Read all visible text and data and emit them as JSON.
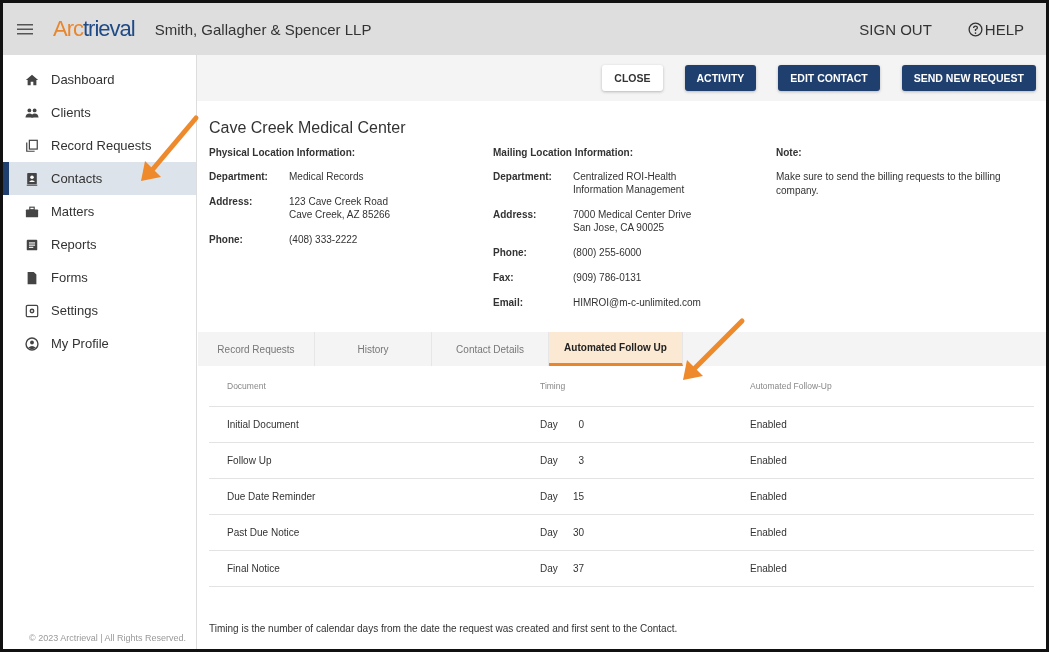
{
  "header": {
    "logo": [
      "Arc",
      "trieval"
    ],
    "firm": "Smith, Gallagher & Spencer LLP",
    "links": [
      {
        "kind": "plain",
        "label": "SIGN OUT"
      },
      {
        "kind": "help",
        "label": "HELP"
      }
    ]
  },
  "sidebar": {
    "items": [
      {
        "label": "Dashboard",
        "selected": false
      },
      {
        "label": "Clients",
        "selected": false
      },
      {
        "label": "Record Requests",
        "selected": false
      },
      {
        "label": "Contacts",
        "selected": true
      },
      {
        "label": "Matters",
        "selected": false
      },
      {
        "label": "Reports",
        "selected": false
      },
      {
        "label": "Forms",
        "selected": false
      },
      {
        "label": "Settings",
        "selected": false
      },
      {
        "label": "My Profile",
        "selected": false
      }
    ],
    "footer": "© 2023 Arctrieval | All Rights Reserved."
  },
  "toolbar": {
    "buttons": [
      {
        "kind": "outline",
        "label": "CLOSE"
      },
      {
        "kind": "primary",
        "label": "ACTIVITY"
      },
      {
        "kind": "primary",
        "label": "EDIT CONTACT"
      },
      {
        "kind": "primary",
        "label": "SEND NEW REQUEST"
      }
    ]
  },
  "contact": {
    "name": "Cave Creek Medical Center",
    "sections": [
      {
        "heading": "Physical Location Information:",
        "fields": [
          {
            "label": "Department:",
            "value": "Medical Records"
          },
          {
            "label": "Address:",
            "value": "123 Cave Creek Road\nCave Creek, AZ 85266"
          },
          {
            "label": "Phone:",
            "value": "(408) 333-2222"
          }
        ]
      },
      {
        "heading": "Mailing Location Information:",
        "fields": [
          {
            "label": "Department:",
            "value": "Centralized ROI-Health\nInformation Management"
          },
          {
            "label": "Address:",
            "value": "7000 Medical Center Drive\nSan Jose, CA 90025"
          },
          {
            "label": "Phone:",
            "value": "(800) 255-6000"
          },
          {
            "label": "Fax:",
            "value": "(909) 786-0131"
          },
          {
            "label": "Email:",
            "value": "HIMROI@m-c-unlimited.com"
          }
        ]
      }
    ],
    "note": {
      "heading": "Note:",
      "text": "Make sure to send the billing requests to the billing company."
    }
  },
  "tabs": [
    {
      "label": "Record Requests",
      "selected": false
    },
    {
      "label": "History",
      "selected": false
    },
    {
      "label": "Contact Details",
      "selected": false
    },
    {
      "label": "Automated Follow Up",
      "selected": true
    }
  ],
  "table": {
    "columns": [
      "Document",
      "Timing",
      "Automated Follow-Up"
    ],
    "rows": [
      {
        "document": "Initial Document",
        "day_label": "Day",
        "day": "0",
        "status": "Enabled"
      },
      {
        "document": "Follow Up",
        "day_label": "Day",
        "day": "3",
        "status": "Enabled"
      },
      {
        "document": "Due Date Reminder",
        "day_label": "Day",
        "day": "15",
        "status": "Enabled"
      },
      {
        "document": "Past Due Notice",
        "day_label": "Day",
        "day": "30",
        "status": "Enabled"
      },
      {
        "document": "Final Notice",
        "day_label": "Day",
        "day": "37",
        "status": "Enabled"
      }
    ]
  },
  "footnote": "Timing is the number of calendar days from the date the request was created and first sent to the Contact."
}
